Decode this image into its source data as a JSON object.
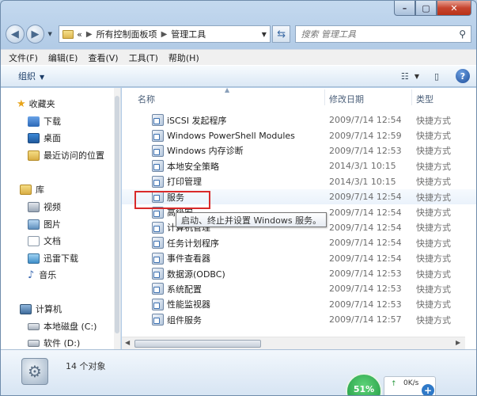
{
  "address": {
    "path": [
      "所有控制面板项",
      "管理工具"
    ],
    "overflow": "«"
  },
  "search": {
    "placeholder": "搜索 管理工具"
  },
  "menu": [
    "文件(F)",
    "编辑(E)",
    "查看(V)",
    "工具(T)",
    "帮助(H)"
  ],
  "toolbar": {
    "organize": "组织"
  },
  "nav": {
    "favorites": "收藏夹",
    "fav_items": [
      "下载",
      "桌面",
      "最近访问的位置"
    ],
    "libraries": "库",
    "lib_items": [
      "视频",
      "图片",
      "文档",
      "迅雷下载",
      "音乐"
    ],
    "computer": "计算机",
    "drives": [
      "本地磁盘 (C:)",
      "软件 (D:)"
    ]
  },
  "columns": {
    "name": "名称",
    "modified": "修改日期",
    "type": "类型"
  },
  "files": [
    {
      "name": "iSCSI 发起程序",
      "date": "2009/7/14 12:54",
      "type": "快捷方式"
    },
    {
      "name": "Windows PowerShell Modules",
      "date": "2009/7/14 12:59",
      "type": "快捷方式"
    },
    {
      "name": "Windows 内存诊断",
      "date": "2009/7/14 12:53",
      "type": "快捷方式"
    },
    {
      "name": "本地安全策略",
      "date": "2014/3/1 10:15",
      "type": "快捷方式"
    },
    {
      "name": "打印管理",
      "date": "2014/3/1 10:15",
      "type": "快捷方式"
    },
    {
      "name": "服务",
      "date": "2009/7/14 12:54",
      "type": "快捷方式"
    },
    {
      "name": "高级安",
      "date": "2009/7/14 12:54",
      "type": "快捷方式"
    },
    {
      "name": "计算机管理",
      "date": "2009/7/14 12:54",
      "type": "快捷方式"
    },
    {
      "name": "任务计划程序",
      "date": "2009/7/14 12:54",
      "type": "快捷方式"
    },
    {
      "name": "事件查看器",
      "date": "2009/7/14 12:54",
      "type": "快捷方式"
    },
    {
      "name": "数据源(ODBC)",
      "date": "2009/7/14 12:53",
      "type": "快捷方式"
    },
    {
      "name": "系统配置",
      "date": "2009/7/14 12:53",
      "type": "快捷方式"
    },
    {
      "name": "性能监视器",
      "date": "2009/7/14 12:53",
      "type": "快捷方式"
    },
    {
      "name": "组件服务",
      "date": "2009/7/14 12:57",
      "type": "快捷方式"
    }
  ],
  "tooltip": "启动、终止并设置 Windows 服务。",
  "status": {
    "count": "14 个对象"
  },
  "net": {
    "percent": "51%",
    "speed": "0K/s"
  },
  "colors": {
    "highlight_box": "#d92a2a",
    "accent": "#1f4f9b"
  }
}
